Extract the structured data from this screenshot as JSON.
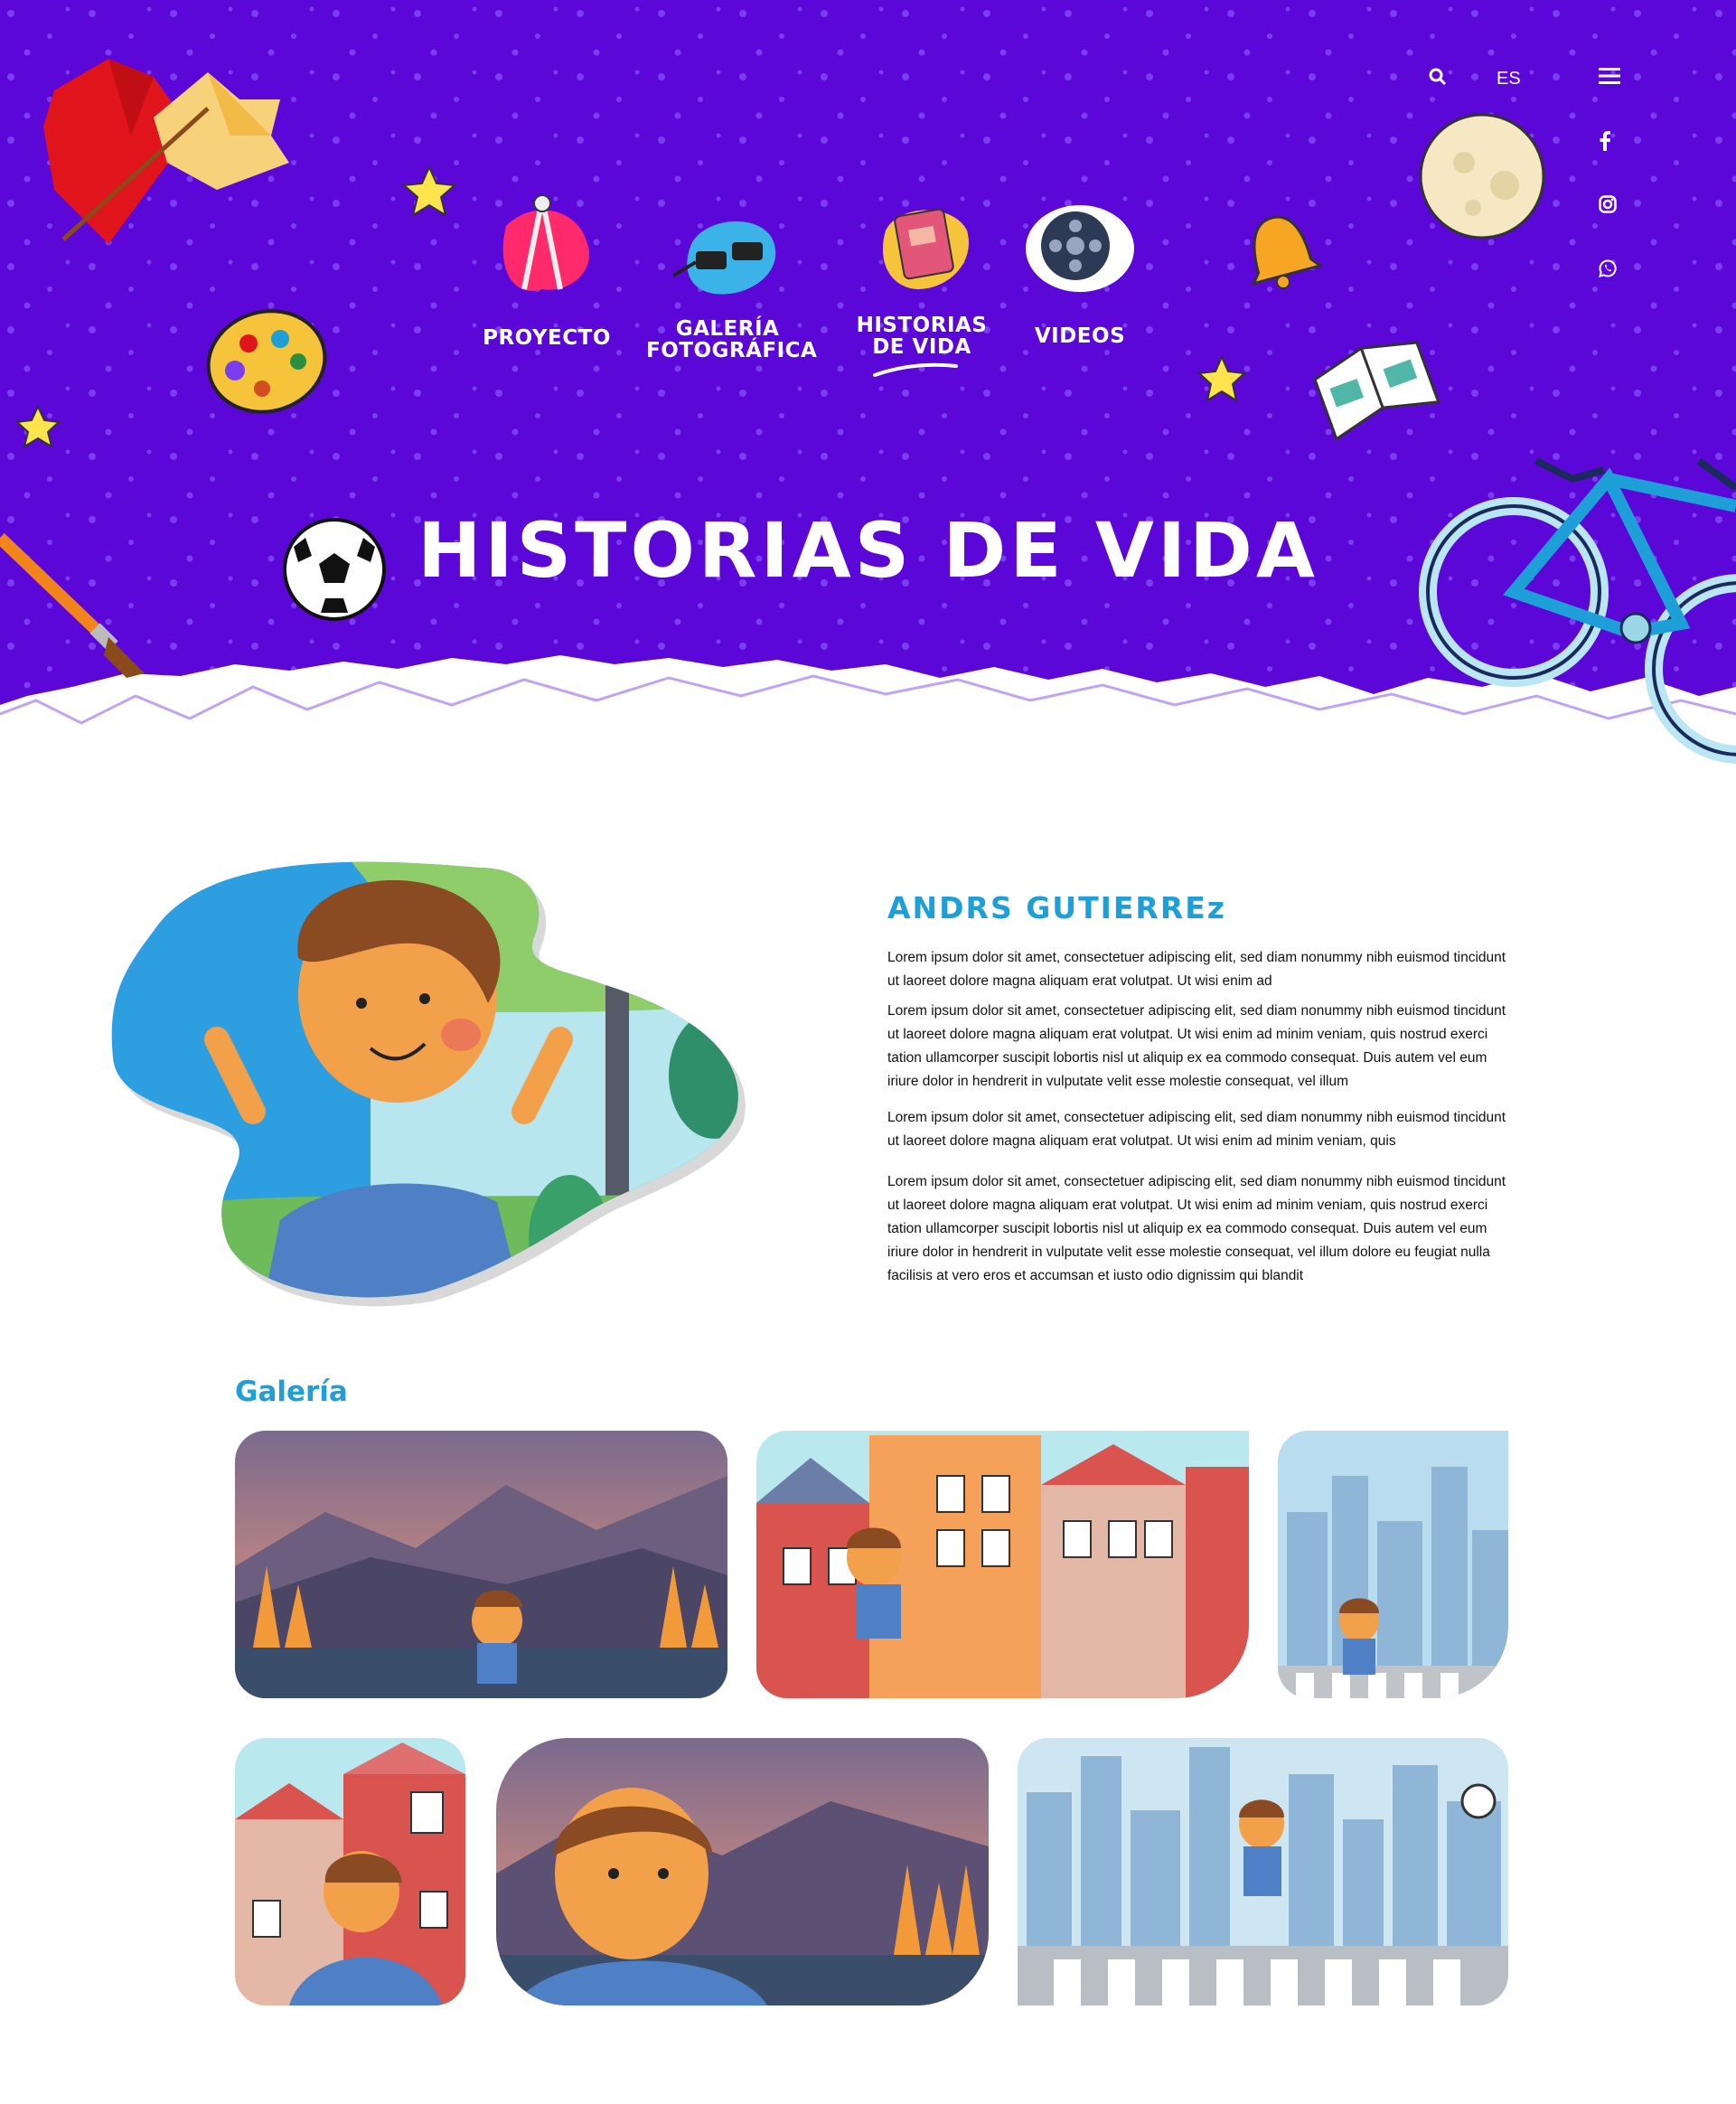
{
  "header": {
    "language": "ES",
    "nav": [
      {
        "label_line1": "PROYECTO",
        "label_line2": ""
      },
      {
        "label_line1": "GALERÍA",
        "label_line2": "FOTOGRÁFICA"
      },
      {
        "label_line1": "HISTORIAS",
        "label_line2": "DE VIDA"
      },
      {
        "label_line1": "VIDEOS",
        "label_line2": ""
      }
    ],
    "active_nav": "HISTORIAS DE VIDA"
  },
  "hero": {
    "title": "HISTORIAS DE VIDA"
  },
  "story": {
    "name": "ANDRS GUTIERREz",
    "paragraphs": [
      "Lorem ipsum dolor sit amet, consectetuer adipiscing elit, sed diam nonummy nibh euismod tincidunt ut laoreet dolore magna aliquam erat volutpat. Ut wisi enim ad",
      "Lorem ipsum dolor sit amet, consectetuer adipiscing elit, sed diam nonummy nibh euismod tincidunt ut laoreet dolore magna aliquam erat volutpat. Ut wisi enim ad minim veniam, quis nostrud exerci tation ullamcorper suscipit lobortis nisl ut aliquip ex ea commodo consequat. Duis autem vel eum iriure dolor in hendrerit in vulputate velit esse molestie consequat, vel illum",
      "Lorem ipsum dolor sit amet, consectetuer adipiscing elit, sed diam nonummy nibh euismod tincidunt ut laoreet dolore magna aliquam erat volutpat. Ut wisi enim ad minim veniam, quis",
      "Lorem ipsum dolor sit amet, consectetuer adipiscing elit, sed diam nonummy nibh euismod tincidunt ut laoreet dolore magna aliquam erat volutpat. Ut wisi enim ad minim veniam, quis nostrud exerci tation ullamcorper suscipit lobortis nisl ut aliquip ex ea commodo consequat. Duis autem vel eum iriure dolor in hendrerit in vulputate velit esse molestie consequat, vel illum dolore eu feugiat nulla facilisis at vero eros et accumsan et iusto odio dignissim qui blandit"
    ]
  },
  "gallery": {
    "title": "Galería"
  },
  "colors": {
    "hero_purple": "#5b07d8",
    "accent_blue": "#1e9fd8"
  },
  "icons": [
    "search-icon",
    "menu-icon",
    "facebook-icon",
    "instagram-icon",
    "whatsapp-icon"
  ]
}
